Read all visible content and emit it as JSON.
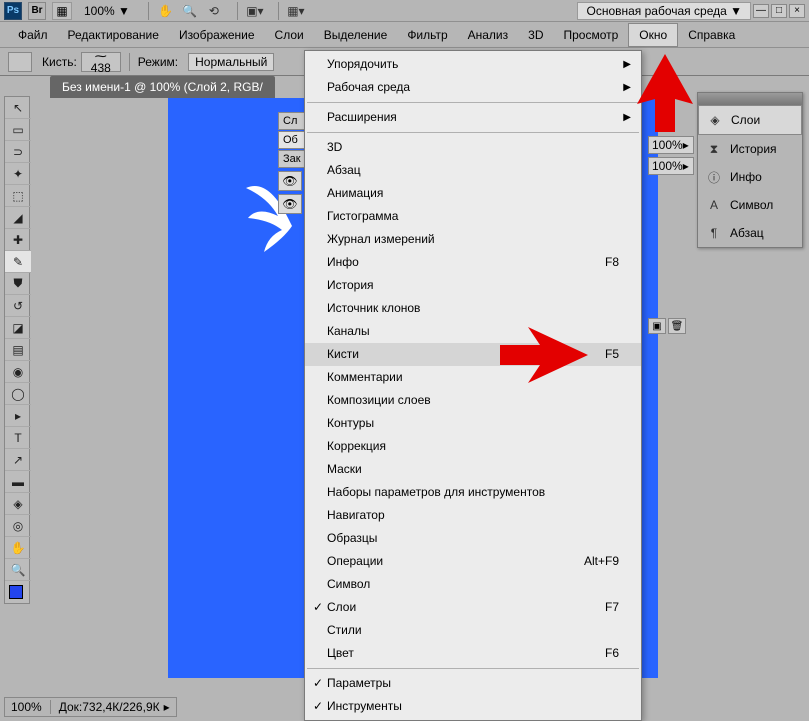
{
  "topbar": {
    "ps": "Ps",
    "br": "Br",
    "zoom": "100% ▼",
    "workspace": "Основная рабочая среда ▼"
  },
  "menubar": {
    "items": [
      "Файл",
      "Редактирование",
      "Изображение",
      "Слои",
      "Выделение",
      "Фильтр",
      "Анализ",
      "3D",
      "Просмотр",
      "Окно",
      "Справка"
    ],
    "active_index": 9
  },
  "optbar": {
    "brush_label": "Кисть:",
    "brush_size": "438",
    "mode_label": "Режим:",
    "mode_value": "Нормальный"
  },
  "doc_tab": "Без имени-1 @ 100% (Слой 2, RGB/",
  "dropdown": {
    "groups": [
      [
        {
          "label": "Упорядочить",
          "arrow": true
        },
        {
          "label": "Рабочая среда",
          "arrow": true
        }
      ],
      [
        {
          "label": "Расширения",
          "arrow": true
        }
      ],
      [
        {
          "label": "3D"
        },
        {
          "label": "Абзац"
        },
        {
          "label": "Анимация"
        },
        {
          "label": "Гистограмма"
        },
        {
          "label": "Журнал измерений"
        },
        {
          "label": "Инфо",
          "shortcut": "F8"
        },
        {
          "label": "История"
        },
        {
          "label": "Источник клонов"
        },
        {
          "label": "Каналы"
        },
        {
          "label": "Кисти",
          "shortcut": "F5",
          "hover": true
        },
        {
          "label": "Комментарии"
        },
        {
          "label": "Композиции слоев"
        },
        {
          "label": "Контуры"
        },
        {
          "label": "Коррекция"
        },
        {
          "label": "Маски"
        },
        {
          "label": "Наборы параметров для инструментов"
        },
        {
          "label": "Навигатор"
        },
        {
          "label": "Образцы"
        },
        {
          "label": "Операции",
          "shortcut": "Alt+F9"
        },
        {
          "label": "Символ"
        },
        {
          "label": "Слои",
          "shortcut": "F7",
          "checked": true
        },
        {
          "label": "Стили"
        },
        {
          "label": "Цвет",
          "shortcut": "F6"
        }
      ],
      [
        {
          "label": "Параметры",
          "checked": true
        },
        {
          "label": "Инструменты",
          "checked": true
        }
      ]
    ]
  },
  "right_panel": {
    "items": [
      {
        "icon": "layers-icon",
        "label": "Слои",
        "active": true
      },
      {
        "icon": "history-icon",
        "label": "История"
      },
      {
        "icon": "info-icon",
        "label": "Инфо"
      },
      {
        "icon": "character-icon",
        "label": "Символ"
      },
      {
        "icon": "paragraph-icon",
        "label": "Абзац"
      }
    ]
  },
  "layers_partial": {
    "tabs": [
      "Сл",
      "Об",
      "Зак"
    ],
    "active": 1
  },
  "opacity": {
    "v1": "100%",
    "v2": "100%"
  },
  "statusbar": {
    "zoom": "100%",
    "doc_label": "Док:",
    "doc_value": "732,4К/226,9К"
  }
}
